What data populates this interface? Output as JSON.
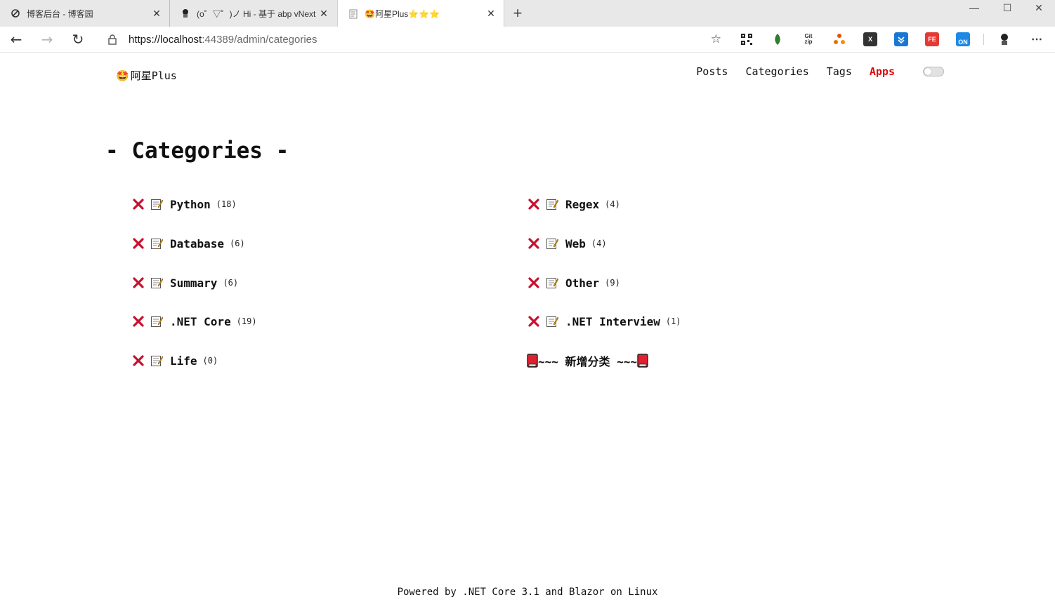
{
  "browser": {
    "tabs": [
      {
        "title": "博客后台 - 博客园",
        "icon": "cnblogs-icon",
        "active": false
      },
      {
        "title": "(o゜▽゜)ノ Hi - 基于 abp vNext 和",
        "icon": "avatar-icon",
        "active": false
      },
      {
        "title": "🤩阿星Plus⭐⭐⭐",
        "icon": "page-icon",
        "active": true
      }
    ],
    "url_base": "https://localhost",
    "url_path": ":44389/admin/categories",
    "extensions": [
      {
        "name": "qr-code-extension-icon",
        "label": "",
        "color": "#222222"
      },
      {
        "name": "puzzle-leaf-extension-icon",
        "label": "",
        "color": "#2e7d32"
      },
      {
        "name": "gitzip-extension-icon",
        "label": "Git zip",
        "color": "#444444"
      },
      {
        "name": "network-extension-icon",
        "label": "",
        "color": "#e65100"
      },
      {
        "name": "x-extension-icon",
        "label": "X",
        "color": "#333333"
      },
      {
        "name": "download-extension-icon",
        "label": "",
        "color": "#1976d2"
      },
      {
        "name": "fe-extension-icon",
        "label": "FE",
        "color": "#e53935"
      },
      {
        "name": "on-extension-icon",
        "label": "ON",
        "color": "#1e88e5"
      }
    ]
  },
  "site": {
    "brand_emoji": "🤩",
    "brand_name": "阿星Plus",
    "nav": [
      {
        "label": "Posts",
        "accent": false
      },
      {
        "label": "Categories",
        "accent": false
      },
      {
        "label": "Tags",
        "accent": false
      },
      {
        "label": "Apps",
        "accent": true
      }
    ],
    "accent_color": "#e0080a"
  },
  "main": {
    "heading": "- Categories -",
    "categories": [
      {
        "name": "Python",
        "count": "(18)"
      },
      {
        "name": "Regex",
        "count": "(4)"
      },
      {
        "name": "Database",
        "count": "(6)"
      },
      {
        "name": "Web",
        "count": "(4)"
      },
      {
        "name": "Summary",
        "count": "(6)"
      },
      {
        "name": "Other",
        "count": "(9)"
      },
      {
        "name": ".NET Core",
        "count": "(19)"
      },
      {
        "name": ".NET Interview",
        "count": "(1)"
      },
      {
        "name": "Life",
        "count": "(0)"
      }
    ],
    "add_label": "~~~ 新增分类 ~~~"
  },
  "footer": {
    "text": "Powered by .NET Core 3.1 and Blazor on Linux"
  }
}
